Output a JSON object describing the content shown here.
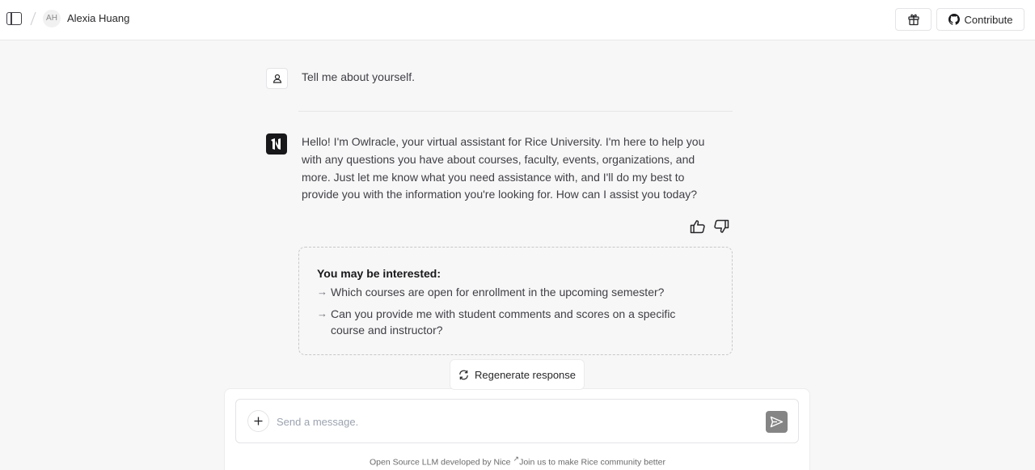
{
  "header": {
    "user_initials": "AH",
    "user_name": "Alexia Huang",
    "contribute_label": "Contribute"
  },
  "conversation": {
    "user_message": "Tell me about yourself.",
    "bot_message": "Hello! I'm Owlracle, your virtual assistant for Rice University. I'm here to help you with any questions you have about courses, faculty, events, organizations, and more. Just let me know what you need assistance with, and I'll do my best to provide you with the information you're looking for. How can I assist you today?"
  },
  "suggestions": {
    "title": "You may be interested:",
    "arrow": "→",
    "items": [
      "Which courses are open for enrollment in the upcoming semester?",
      "Can you provide me with student comments and scores on a specific course and instructor?"
    ]
  },
  "regenerate_label": "Regenerate response",
  "composer": {
    "placeholder": "Send a message.",
    "value": ""
  },
  "footer": {
    "text": "Open Source LLM developed by Nice",
    "link_text": "Join us to make Rice community better"
  },
  "icons": {
    "sidebar": "sidebar-toggle-icon",
    "gift": "gift-icon",
    "github": "github-icon",
    "user": "user-icon",
    "bot_logo": "owlracle-logo-icon",
    "thumb_up": "thumbs-up-icon",
    "thumb_down": "thumbs-down-icon",
    "regenerate": "refresh-icon",
    "plus": "plus-icon",
    "send": "send-icon",
    "external": "external-link-icon"
  },
  "colors": {
    "background": "#f7f7f7",
    "bot_badge": "#18181b",
    "send_button": "#858585"
  }
}
